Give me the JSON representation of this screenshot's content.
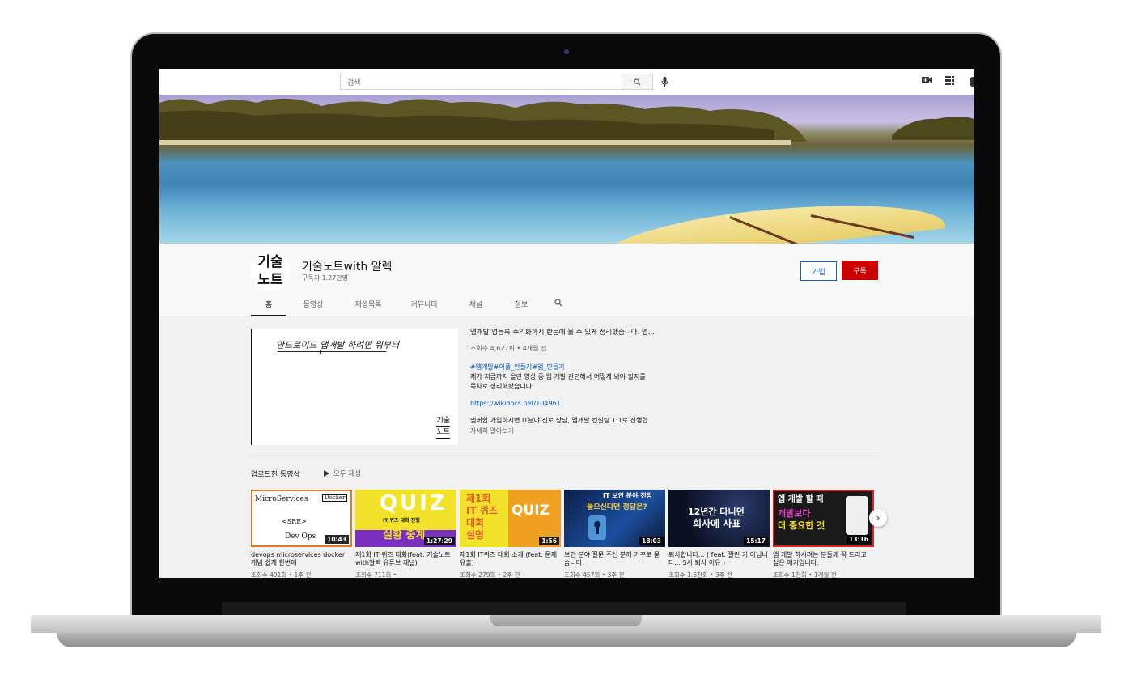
{
  "topbar": {
    "search_placeholder": "검색",
    "icons": [
      "search-icon",
      "mic-icon",
      "create-video-icon",
      "apps-grid-icon",
      "bell-icon"
    ]
  },
  "channel": {
    "avatar_text_line1": "기술",
    "avatar_text_line2": "노트",
    "name": "기술노트with 알렉",
    "subscribers": "구독자 1.27만명",
    "join_label": "가입",
    "subscribe_label": "구독"
  },
  "tabs": [
    {
      "label": "홈",
      "active": true
    },
    {
      "label": "동영상"
    },
    {
      "label": "재생목록"
    },
    {
      "label": "커뮤니티"
    },
    {
      "label": "채널"
    },
    {
      "label": "정보"
    }
  ],
  "featured": {
    "handwriting": "안드로이드 앱개발 하려면 뭐부터",
    "logo_line1": "기술",
    "logo_line2": "노트",
    "title": "앱개발 업등록 수익화까지 한눈에 볼 수 있게 정리했습니다. 앱...",
    "meta": "조회수 4,627회 • 4개월 전",
    "tags": "#앱개발#어플_만들기#앱_만들기",
    "description_line1": "제가 지금까지 올린 영상 중 앱 개발 관련해서 어떻게 봐야 할지를",
    "description_line2": "목차로 정리해봤습니다.",
    "link": "https://wikidocs.net/104961",
    "description_line3": "멤버쉽 가입하시면 IT분야 진로 상담, 앱개발 컨설팅 1:1로 진행합",
    "more": "자세히 알아보기"
  },
  "uploads": {
    "section_title": "업로드한 동영상",
    "play_all_label": "모두 재생",
    "videos": [
      {
        "title": "devops microservices docker 개념 쉽게 한번에",
        "duration": "10:43",
        "meta": "조회수 491회 • 1주 전",
        "thumb_text": [
          "MicroServices",
          "Docker",
          "<SRE>",
          "Dev Ops"
        ]
      },
      {
        "title": "제1회 IT 퀴즈 대회(feat. 기술노트with알렉 유튜브 채널)",
        "duration": "1:27:29",
        "meta": "조회수 711회 •",
        "thumb_text": [
          "QUIZ",
          "IT 퀴즈 대회 진행",
          "실황 중계"
        ]
      },
      {
        "title": "제1회 IT퀴즈 대회 소개 (feat. 문제 유출)",
        "duration": "1:56",
        "meta": "조회수 279회 • 2주 전",
        "thumb_text": [
          "제1회",
          "IT 퀴즈",
          "대회",
          "설명",
          "QUIZ"
        ]
      },
      {
        "title": "보안 분야 질문 주신 분께 거꾸로 묻습니다.",
        "duration": "18:03",
        "meta": "조회수 457회 • 3주 전",
        "thumb_text": [
          "IT 보안 분야 전망",
          "물으신다면 정답은?"
        ]
      },
      {
        "title": "퇴사합니다... ( feat. 짤린 거 아닙니다... S사 퇴사 이유 )",
        "duration": "15:17",
        "meta": "조회수 1.6천회 • 3주 전",
        "thumb_text": [
          "12년간 다니던",
          "회사에 사표"
        ]
      },
      {
        "title": "앱 개발 하시려는 분들께 꼭 드리고 싶은 얘기입니다.",
        "duration": "13:16",
        "meta": "조회수 1천회 • 1개월 전",
        "thumb_text": [
          "앱 개발 할 때",
          "개발보다",
          "더 중요한 것"
        ]
      }
    ]
  },
  "colors": {
    "subscribe_red": "#cc0000",
    "join_blue": "#065fd4",
    "link_blue": "#065fd4"
  }
}
